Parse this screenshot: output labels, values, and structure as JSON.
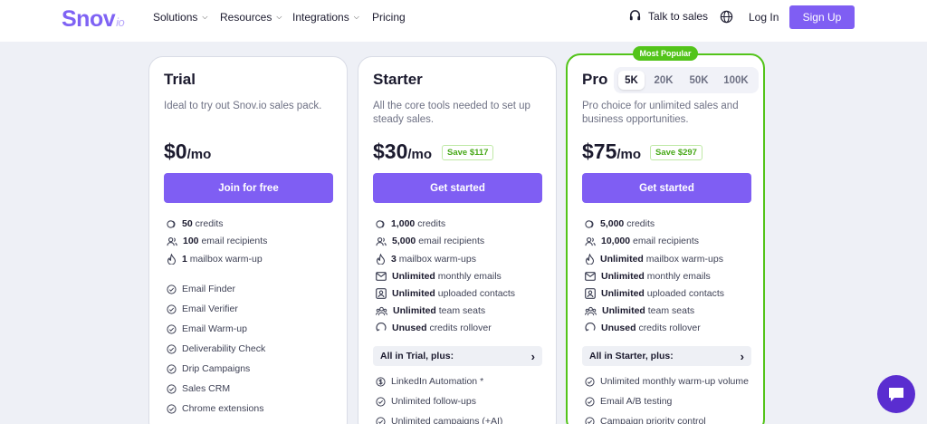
{
  "header": {
    "logo_main": "Snov",
    "logo_suffix": "io",
    "nav": [
      "Solutions",
      "Resources",
      "Integrations",
      "Pricing"
    ],
    "talk_to_sales": "Talk to sales",
    "login": "Log In",
    "signup": "Sign Up"
  },
  "plans": {
    "trial": {
      "name": "Trial",
      "description": "Ideal to try out Snov.io sales pack.",
      "price": "$0",
      "period": "/mo",
      "cta": "Join for free",
      "limits": [
        {
          "value": "50",
          "label": "credits"
        },
        {
          "value": "100",
          "label": "email recipients"
        },
        {
          "value": "1",
          "label": "mailbox warm-up"
        }
      ],
      "features": [
        "Email Finder",
        "Email Verifier",
        "Email Warm-up",
        "Deliverability Check",
        "Drip Campaigns",
        "Sales CRM",
        "Chrome extensions"
      ]
    },
    "starter": {
      "name": "Starter",
      "description": "All the core tools needed to set up steady sales.",
      "price": "$30",
      "period": "/mo",
      "save": "Save $117",
      "cta": "Get started",
      "limits": [
        {
          "value": "1,000",
          "label": "credits"
        },
        {
          "value": "5,000",
          "label": "email recipients"
        },
        {
          "value": "3",
          "label": "mailbox warm-ups"
        },
        {
          "value": "Unlimited",
          "label": "monthly emails"
        },
        {
          "value": "Unlimited",
          "label": "uploaded contacts"
        },
        {
          "value": "Unlimited",
          "label": "team seats"
        },
        {
          "value": "Unused",
          "label": "credits rollover"
        }
      ],
      "plus_label": "All in Trial, plus:",
      "features": [
        "LinkedIn Automation *",
        "Unlimited follow-ups",
        "Unlimited campaigns (+AI)"
      ]
    },
    "pro": {
      "badge": "Most Popular",
      "name": "Pro",
      "tiers": [
        "5K",
        "20K",
        "50K",
        "100K"
      ],
      "active_tier": "5K",
      "description": "Pro choice for unlimited sales and business opportunities.",
      "price": "$75",
      "period": "/mo",
      "save": "Save $297",
      "cta": "Get started",
      "limits": [
        {
          "value": "5,000",
          "label": "credits"
        },
        {
          "value": "10,000",
          "label": "email recipients"
        },
        {
          "value": "Unlimited",
          "label": "mailbox warm-ups"
        },
        {
          "value": "Unlimited",
          "label": "monthly emails"
        },
        {
          "value": "Unlimited",
          "label": "uploaded contacts"
        },
        {
          "value": "Unlimited",
          "label": "team seats"
        },
        {
          "value": "Unused",
          "label": "credits rollover"
        }
      ],
      "plus_label": "All in Starter, plus:",
      "features": [
        "Unlimited monthly warm-up volume",
        "Email A/B testing",
        "Campaign priority control"
      ]
    }
  },
  "colors": {
    "accent": "#7f5ef3",
    "popular": "#53c41a",
    "chat": "#5a2dd0"
  }
}
